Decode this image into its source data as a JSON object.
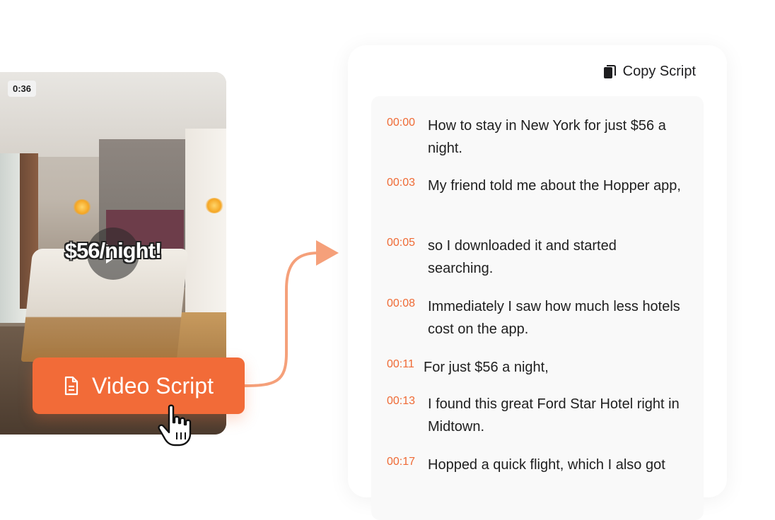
{
  "video": {
    "duration": "0:36",
    "overlay_text": "$56/night!",
    "play_icon": "play-icon"
  },
  "button": {
    "label": "Video Script",
    "icon": "document-icon"
  },
  "cursor_icon": "hand-pointer-icon",
  "copy": {
    "label": "Copy Script",
    "icon": "copy-icon"
  },
  "colors": {
    "accent": "#f26b38",
    "timestamp": "#ef6a35",
    "arrow": "#f5a07a"
  },
  "transcript": [
    {
      "time": "00:00",
      "text": "How to stay in New York for just $56 a night."
    },
    {
      "time": "00:03",
      "text": "My friend told me about the Hopper app,"
    },
    {
      "time": "00:05",
      "text": "so I downloaded it and started searching."
    },
    {
      "time": "00:08",
      "text": "Immediately I saw how much less hotels cost on the app."
    },
    {
      "time": "00:11",
      "text": "For just $56 a night,"
    },
    {
      "time": "00:13",
      "text": "I found this great Ford Star Hotel right in Midtown."
    },
    {
      "time": "00:17",
      "text": "Hopped a quick flight, which I also got"
    }
  ]
}
